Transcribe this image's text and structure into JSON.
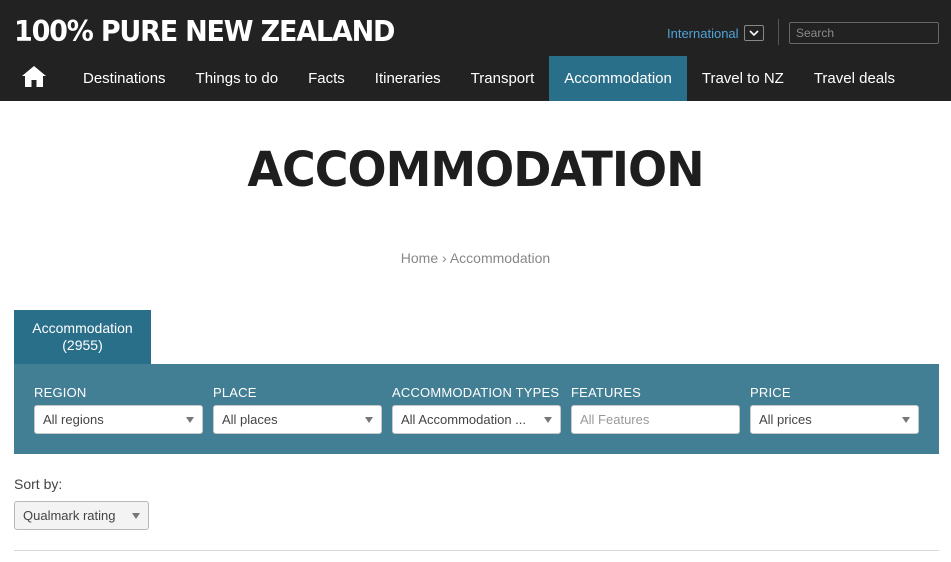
{
  "header": {
    "logo_text": "100% PURE NEW ZEALAND",
    "region": "International",
    "search_placeholder": "Search"
  },
  "nav": {
    "home_icon": "home-icon",
    "items": [
      {
        "label": "Destinations"
      },
      {
        "label": "Things to do"
      },
      {
        "label": "Facts"
      },
      {
        "label": "Itineraries"
      },
      {
        "label": "Transport"
      },
      {
        "label": "Accommodation",
        "active": true
      },
      {
        "label": "Travel to NZ"
      },
      {
        "label": "Travel deals"
      }
    ]
  },
  "page": {
    "title": "ACCOMMODATION",
    "breadcrumb": {
      "home": "Home",
      "separator": "›",
      "current": "Accommodation"
    }
  },
  "tab": {
    "label": "Accommodation",
    "count": "(2955)"
  },
  "filters": {
    "region": {
      "label": "REGION",
      "value": "All regions"
    },
    "place": {
      "label": "PLACE",
      "value": "All places"
    },
    "types": {
      "label": "ACCOMMODATION TYPES",
      "value": "All Accommodation ..."
    },
    "features": {
      "label": "FEATURES",
      "placeholder": "All Features"
    },
    "price": {
      "label": "PRICE",
      "value": "All prices"
    }
  },
  "sort": {
    "label": "Sort by:",
    "value": "Qualmark rating"
  },
  "colors": {
    "header_bg": "#222222",
    "accent": "#2a6f8a",
    "filter_bg": "#427e94",
    "region_link": "#4fa3d9"
  }
}
